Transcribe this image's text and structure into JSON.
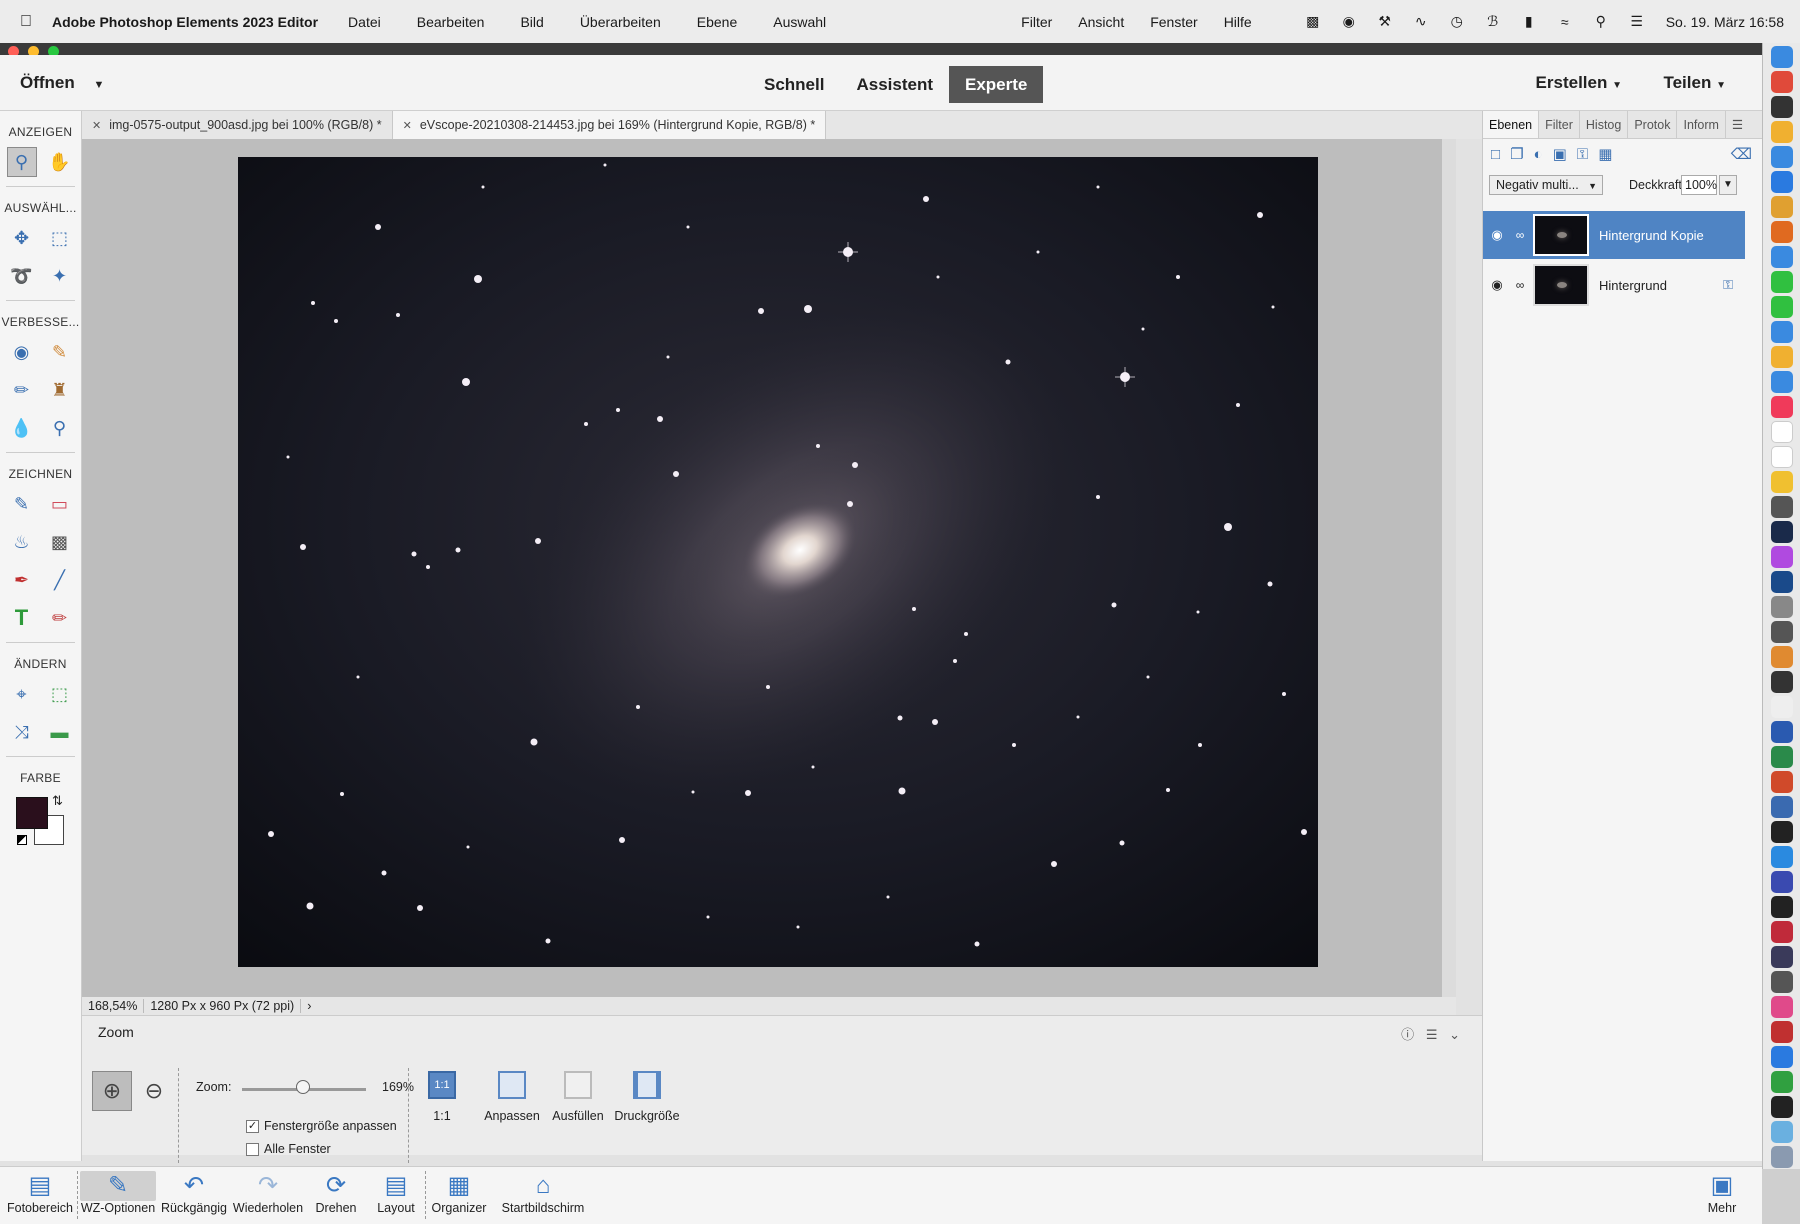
{
  "menubar": {
    "app_name": "Adobe Photoshop Elements 2023 Editor",
    "items": [
      "Datei",
      "Bearbeiten",
      "Bild",
      "Überarbeiten",
      "Ebene",
      "Auswahl"
    ],
    "right_items": [
      "Filter",
      "Ansicht",
      "Fenster",
      "Hilfe"
    ],
    "clock": "So. 19. März  16:58"
  },
  "topbar": {
    "open_label": "Öffnen",
    "modes": [
      "Schnell",
      "Assistent",
      "Experte"
    ],
    "active_mode": "Experte",
    "create_label": "Erstellen",
    "share_label": "Teilen"
  },
  "toolbox": {
    "sections": {
      "view": "ANZEIGEN",
      "select": "AUSWÄHL...",
      "enhance": "VERBESSE...",
      "draw": "ZEICHNEN",
      "modify": "ÄNDERN",
      "color": "FARBE"
    }
  },
  "colors": {
    "foreground": "#2a0f1c",
    "background": "#ffffff",
    "accent": "#4f84c4"
  },
  "document_tabs": [
    {
      "label": "img-0575-output_900asd.jpg bei 100% (RGB/8) *",
      "active": false
    },
    {
      "label": "eVscope-20210308-214453.jpg bei 169% (Hintergrund Kopie, RGB/8) *",
      "active": true
    }
  ],
  "status": {
    "zoom": "168,54%",
    "dimensions": "1280 Px x 960 Px (72 ppi)"
  },
  "tool_options": {
    "title": "Zoom",
    "zoom_label": "Zoom:",
    "zoom_value": "169%",
    "zoom_fraction": 0.49,
    "fit_window_label": "Fenstergröße anpassen",
    "fit_window_checked": true,
    "all_windows_label": "Alle Fenster",
    "all_windows_checked": false,
    "view_buttons": [
      {
        "icon": "1:1",
        "label": "1:1"
      },
      {
        "label": "Anpassen"
      },
      {
        "label": "Ausfüllen"
      },
      {
        "label": "Druckgröße"
      }
    ]
  },
  "panel": {
    "tabs": [
      "Ebenen",
      "Filter",
      "Histog",
      "Protok",
      "Inform"
    ],
    "active_tab": "Ebenen",
    "blend_mode": "Negativ multi...",
    "opacity_label": "Deckkraft:",
    "opacity_value": "100%",
    "layers": [
      {
        "name": "Hintergrund Kopie",
        "selected": true
      },
      {
        "name": "Hintergrund",
        "selected": false
      }
    ]
  },
  "taskbar": {
    "items": [
      "Fotobereich",
      "WZ-Optionen",
      "Rückgängig",
      "Wiederholen",
      "Drehen",
      "Layout",
      "Organizer",
      "Startbildschirm"
    ],
    "more": "Mehr"
  }
}
